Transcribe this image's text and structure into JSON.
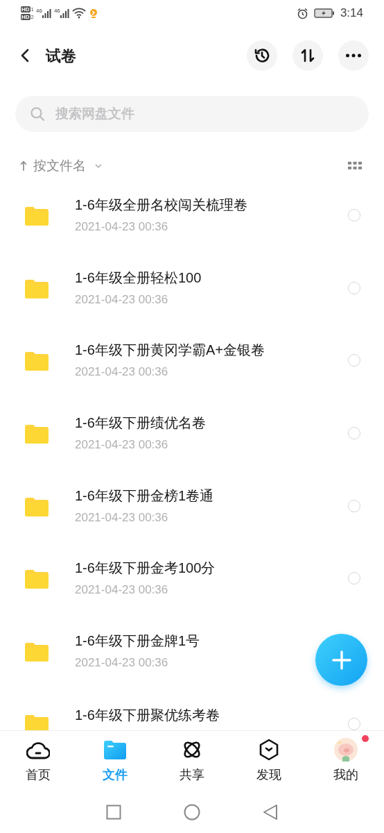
{
  "status_bar": {
    "sims": [
      {
        "badge": "HD",
        "slot": "1",
        "network": "46"
      },
      {
        "badge": "HD",
        "slot": "2",
        "network": "46"
      }
    ],
    "time": "3:14"
  },
  "header": {
    "title": "试卷"
  },
  "search": {
    "placeholder": "搜索网盘文件"
  },
  "sort": {
    "label": "按文件名"
  },
  "files": [
    {
      "name": "1-6年级全册名校闯关梳理卷",
      "date": "2021-04-23  00:36",
      "selected": false
    },
    {
      "name": "1-6年级全册轻松100",
      "date": "2021-04-23  00:36",
      "selected": false
    },
    {
      "name": "1-6年级下册黄冈学霸A+金银卷",
      "date": "2021-04-23  00:36",
      "selected": false
    },
    {
      "name": "1-6年级下册绩优名卷",
      "date": "2021-04-23  00:36",
      "selected": false
    },
    {
      "name": "1-6年级下册金榜1卷通",
      "date": "2021-04-23  00:36",
      "selected": false
    },
    {
      "name": "1-6年级下册金考100分",
      "date": "2021-04-23  00:36",
      "selected": false
    },
    {
      "name": "1-6年级下册金牌1号",
      "date": "2021-04-23  00:36"
    },
    {
      "name": "1-6年级下册聚优练考卷",
      "selected": false
    }
  ],
  "tabs": [
    {
      "kind": "home",
      "label": "首页",
      "selected": false
    },
    {
      "kind": "files",
      "label": "文件",
      "selected": true
    },
    {
      "kind": "share",
      "label": "共享",
      "selected": false
    },
    {
      "kind": "discover",
      "label": "发现",
      "selected": false
    },
    {
      "kind": "me",
      "label": "我的",
      "selected": false,
      "badge": true
    }
  ]
}
